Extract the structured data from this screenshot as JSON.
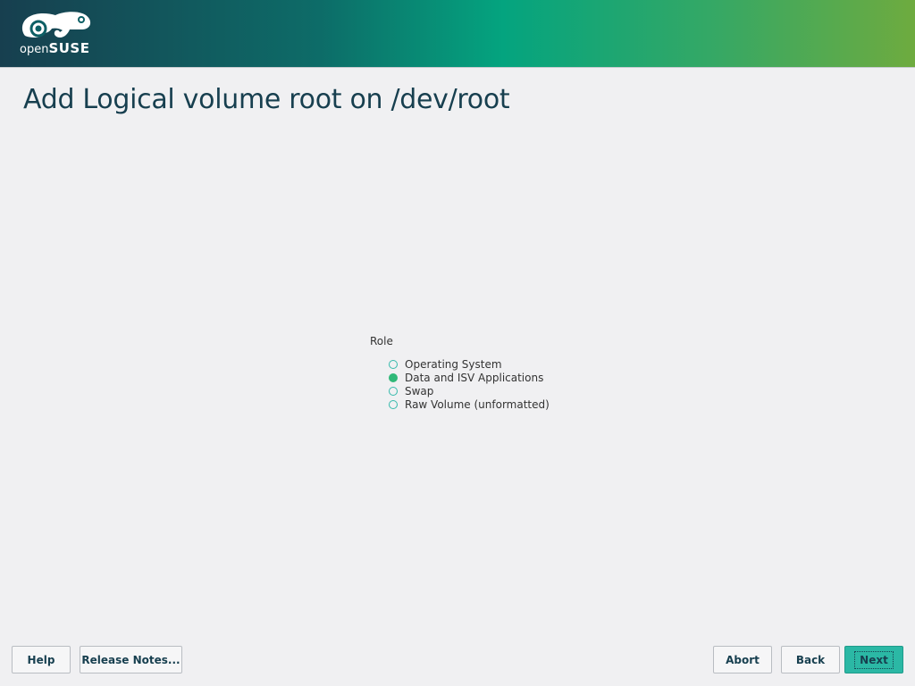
{
  "header": {
    "logo_open": "open",
    "logo_suse": "SUSE",
    "banner_colors": [
      "#173f4f",
      "#04a47f",
      "#6eab3f"
    ]
  },
  "page": {
    "title": "Add Logical volume root on /dev/root"
  },
  "role": {
    "label": "Role",
    "selected": "Data and ISV Applications",
    "options": [
      {
        "label": "Operating System",
        "checked": false
      },
      {
        "label": "Data and ISV Applications",
        "checked": true
      },
      {
        "label": "Swap",
        "checked": false
      },
      {
        "label": "Raw Volume (unformatted)",
        "checked": false
      }
    ]
  },
  "footer": {
    "help": "Help",
    "release_notes": "Release Notes...",
    "abort": "Abort",
    "back": "Back",
    "next": "Next"
  },
  "colors": {
    "accent": "#2bb8a5",
    "radio_selected": "#30b878",
    "title": "#173f4f"
  }
}
